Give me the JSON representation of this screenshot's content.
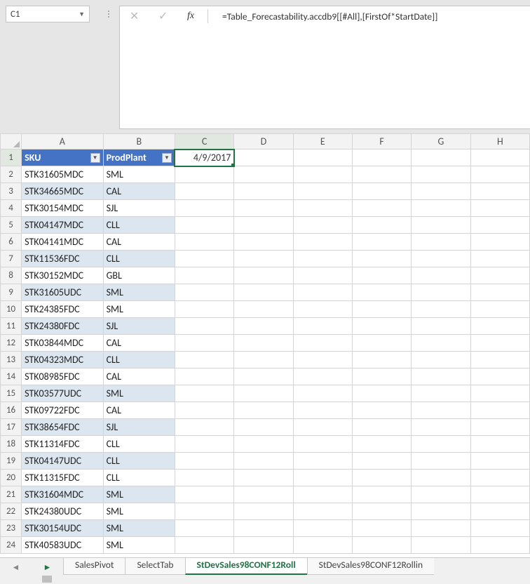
{
  "namebox": {
    "value": "C1"
  },
  "formula": {
    "value": "=Table_Forecastability.accdb9[[#All],[FirstOf*StartDate]]"
  },
  "columns": [
    "A",
    "B",
    "C",
    "D",
    "E",
    "F",
    "G",
    "H"
  ],
  "tableHeaders": {
    "A": "SKU",
    "B": "ProdPlant"
  },
  "activeCell": {
    "row": 1,
    "col": "C",
    "value": "4/9/2017"
  },
  "rows": [
    {
      "n": 2,
      "sku": "STK31605MDC",
      "plant": "SML"
    },
    {
      "n": 3,
      "sku": "STK34665MDC",
      "plant": "CAL"
    },
    {
      "n": 4,
      "sku": "STK30154MDC",
      "plant": "SJL"
    },
    {
      "n": 5,
      "sku": "STK04147MDC",
      "plant": "CLL"
    },
    {
      "n": 6,
      "sku": "STK04141MDC",
      "plant": "CAL"
    },
    {
      "n": 7,
      "sku": "STK11536FDC",
      "plant": "CLL"
    },
    {
      "n": 8,
      "sku": "STK30152MDC",
      "plant": "GBL"
    },
    {
      "n": 9,
      "sku": "STK31605UDC",
      "plant": "SML"
    },
    {
      "n": 10,
      "sku": "STK24385FDC",
      "plant": "SML"
    },
    {
      "n": 11,
      "sku": "STK24380FDC",
      "plant": "SJL"
    },
    {
      "n": 12,
      "sku": "STK03844MDC",
      "plant": "CAL"
    },
    {
      "n": 13,
      "sku": "STK04323MDC",
      "plant": "CLL"
    },
    {
      "n": 14,
      "sku": "STK08985FDC",
      "plant": "CAL"
    },
    {
      "n": 15,
      "sku": "STK03577UDC",
      "plant": "SML"
    },
    {
      "n": 16,
      "sku": "STK09722FDC",
      "plant": "CAL"
    },
    {
      "n": 17,
      "sku": "STK38654FDC",
      "plant": "SJL"
    },
    {
      "n": 18,
      "sku": "STK11314FDC",
      "plant": "CLL"
    },
    {
      "n": 19,
      "sku": "STK04147UDC",
      "plant": "CLL"
    },
    {
      "n": 20,
      "sku": "STK11315FDC",
      "plant": "CLL"
    },
    {
      "n": 21,
      "sku": "STK31604MDC",
      "plant": "SML"
    },
    {
      "n": 22,
      "sku": "STK24380UDC",
      "plant": "SML"
    },
    {
      "n": 23,
      "sku": "STK30154UDC",
      "plant": "SML"
    },
    {
      "n": 24,
      "sku": "STK40583UDC",
      "plant": "SML"
    }
  ],
  "sheetTabs": [
    {
      "label": "SalesPivot",
      "active": false
    },
    {
      "label": "SelectTab",
      "active": false
    },
    {
      "label": "StDevSales98CONF12Roll",
      "active": true
    },
    {
      "label": "StDevSales98CONF12Rollin",
      "active": false
    }
  ]
}
